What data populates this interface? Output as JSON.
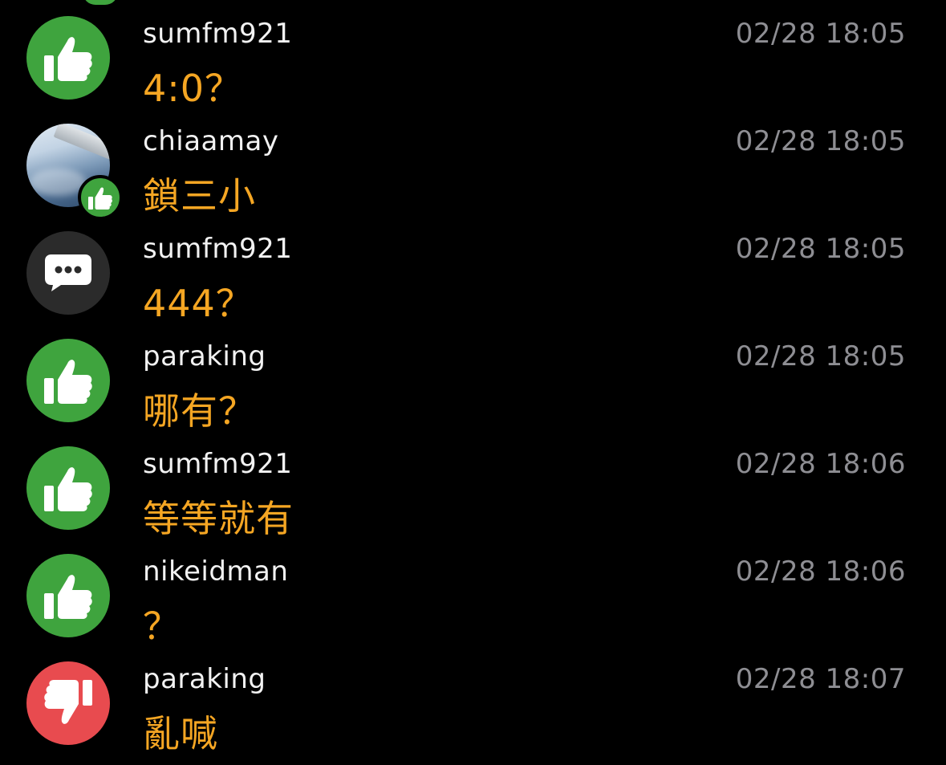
{
  "colors": {
    "background": "#000000",
    "like": "#3fa43e",
    "neutral": "#2b2b2b",
    "dislike": "#e84b4f",
    "username": "#f2f2f2",
    "timestamp": "#8e8e93",
    "message": "#f5a623"
  },
  "comments": [
    {
      "reaction": "thumbs-up-icon",
      "username": "sumfm921",
      "time": "02/28 18:05",
      "message": "4:0？"
    },
    {
      "reaction": "thumbs-up-icon",
      "avatar": "photo",
      "username": "chiaamay",
      "time": "02/28 18:05",
      "message": "鎖三小"
    },
    {
      "reaction": "speech-bubble-icon",
      "username": "sumfm921",
      "time": "02/28 18:05",
      "message": "444？"
    },
    {
      "reaction": "thumbs-up-icon",
      "username": "paraking",
      "time": "02/28 18:05",
      "message": "哪有？"
    },
    {
      "reaction": "thumbs-up-icon",
      "username": "sumfm921",
      "time": "02/28 18:06",
      "message": "等等就有"
    },
    {
      "reaction": "thumbs-up-icon",
      "username": "nikeidman",
      "time": "02/28 18:06",
      "message": "？"
    },
    {
      "reaction": "thumbs-down-icon",
      "username": "paraking",
      "time": "02/28 18:07",
      "message": "亂喊"
    }
  ]
}
